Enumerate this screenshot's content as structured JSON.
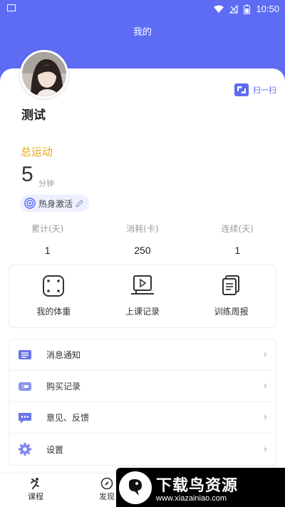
{
  "status_bar": {
    "time": "10:50"
  },
  "header": {
    "title": "我的"
  },
  "profile": {
    "username": "测试",
    "scan_label": "扫一扫"
  },
  "summary": {
    "label": "总运动",
    "value": "5",
    "unit": "分钟",
    "badge": "热身激活"
  },
  "stats": [
    {
      "label": "累计(天)",
      "value": "1"
    },
    {
      "label": "消耗(卡)",
      "value": "250"
    },
    {
      "label": "连续(天)",
      "value": "1"
    }
  ],
  "quick_actions": [
    {
      "label": "我的体重",
      "icon": "scale-icon"
    },
    {
      "label": "上课记录",
      "icon": "class-record-icon"
    },
    {
      "label": "训练周报",
      "icon": "weekly-report-icon"
    }
  ],
  "menu": [
    {
      "label": "消息通知",
      "icon": "message-icon"
    },
    {
      "label": "购买记录",
      "icon": "wallet-icon"
    },
    {
      "label": "意见、反馈",
      "icon": "feedback-icon"
    },
    {
      "label": "设置",
      "icon": "settings-icon"
    }
  ],
  "tabs": [
    {
      "label": "课程",
      "icon": "run-icon"
    },
    {
      "label": "发现",
      "icon": "compass-icon"
    }
  ],
  "watermark": {
    "name": "下载鸟资源",
    "url": "www.xiazainiao.com"
  },
  "colors": {
    "primary": "#5d6cf2",
    "accent": "#e8a619"
  }
}
